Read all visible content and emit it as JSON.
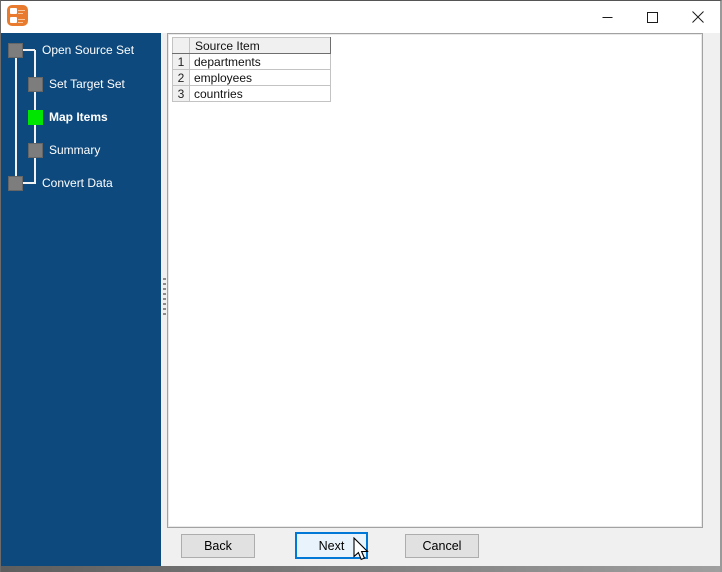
{
  "window": {
    "icon": "converter-app-icon",
    "controls": {
      "minimize": "minimize",
      "maximize": "maximize",
      "close": "close"
    }
  },
  "sidebar": {
    "steps": [
      {
        "label": "Open Source Set",
        "state": "pending"
      },
      {
        "label": "Set Target Set",
        "state": "pending"
      },
      {
        "label": "Map Items",
        "state": "active"
      },
      {
        "label": "Summary",
        "state": "pending"
      },
      {
        "label": "Convert Data",
        "state": "pending"
      }
    ]
  },
  "main": {
    "table": {
      "columns": [
        "",
        "Source Item"
      ],
      "rows": [
        {
          "num": "1",
          "item": "departments"
        },
        {
          "num": "2",
          "item": "employees"
        },
        {
          "num": "3",
          "item": "countries"
        }
      ]
    }
  },
  "footer": {
    "back_label": "Back",
    "next_label": "Next",
    "cancel_label": "Cancel"
  },
  "colors": {
    "sidebar_bg": "#0d497d",
    "active_step_green": "#00e600",
    "step_box_gray": "#7d7d7d",
    "accent_blue": "#0078d7",
    "button_face": "#e1e1e1",
    "panel_bg": "#ffffff",
    "footer_bg": "#f0f0f0"
  }
}
